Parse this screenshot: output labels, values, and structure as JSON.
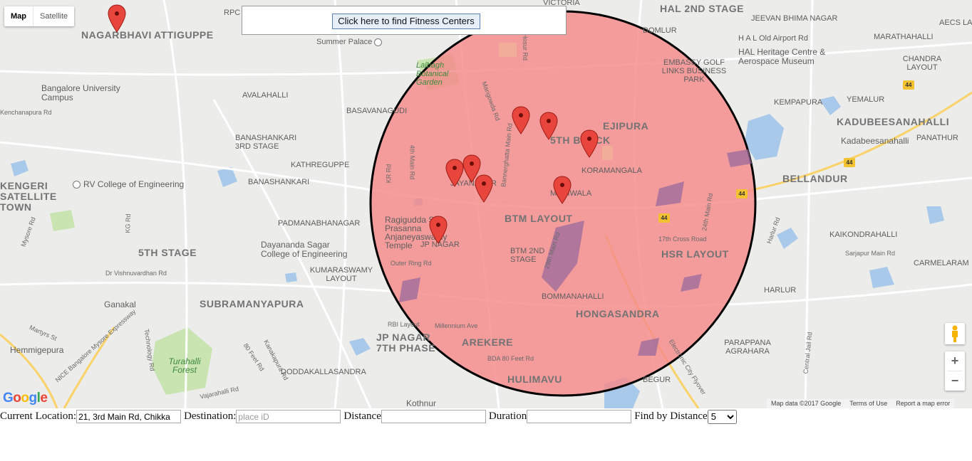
{
  "map": {
    "type_buttons": {
      "map": "Map",
      "satellite": "Satellite"
    },
    "find_button": "Click here to find Fitness Centers",
    "zoom_in": "+",
    "zoom_out": "−",
    "logo": "Google",
    "attribution": {
      "data": "Map data ©2017 Google",
      "terms": "Terms of Use",
      "report": "Report a map error"
    },
    "colors": {
      "radius_fill": "#f48a8a",
      "radius_stroke": "#000000",
      "pin": "#e8463d",
      "water": "#a9c9ea",
      "park": "#c9e3b1"
    },
    "labels": {
      "nagarbhavi": "NAGARBHAVI",
      "attiguppe": "ATTIGUPPE",
      "rpc_layout": "RPC LAYOUT",
      "victoria": "VICTORIA",
      "hal_2nd_stage": "HAL 2ND STAGE",
      "jeevan_bhima": "JEEVAN BHIMA NAGAR",
      "hal_old_airport": "H A L Old Airport Rd",
      "marathahalli": "MARATHAHALLI",
      "aecs": "AECS LAY",
      "summer_palace": "Summer Palace",
      "domlur": "DOMLUR",
      "hal_heritage": "HAL Heritage Centre & Aerospace Museum",
      "chandra_layout": "CHANDRA LAYOUT",
      "lalbagh": "Lalbagh Botanical Garden",
      "embassy": "EMBASSY GOLF LINKS BUSINESS PARK",
      "bangalore_univ": "Bangalore University Campus",
      "avalahalli": "AVALAHALLI",
      "yemalur": "YEMALUR",
      "kenchanapura": "Kenchanapura Rd",
      "basavanagudi": "BASAVANAGUDI",
      "kempapura": "KEMPAPURA",
      "ejipura": "EJIPURA",
      "kadubeesanahalli": "KADUBEESANAHALLI",
      "fifth_block": "5TH BLOCK",
      "kadabeesanahalli": "Kadabeesanahalli",
      "panathur": "PANATHUR",
      "banashankari_3": "BANASHANKARI 3RD STAGE",
      "kathreguppe": "KATHREGUPPE",
      "koramangala": "KORAMANGALA",
      "kengeri": "KENGERI SATELLITE TOWN",
      "banashankari": "BANASHANKARI",
      "jayanagar": "JAYANAGAR",
      "bellandur": "BELLANDUR",
      "rv_college": "RV College of Engineering",
      "madiwala": "MADIWALA",
      "btm_layout": "BTM LAYOUT",
      "padmanabhanagar": "PADMANABHANAGAR",
      "ragigudda": "Ragigudda Sri Prasanna Anjaneyaswamy Temple",
      "kaikondrahalli": "KAIKONDRAHALLI",
      "jp_nagar": "JP NAGAR",
      "seventeenth_cross": "17th Cross Road",
      "dayananda": "Dayananda Sagar College of Engineering",
      "fifth_stage": "5TH STAGE",
      "btm_2nd": "BTM 2ND STAGE",
      "hsr_layout": "HSR LAYOUT",
      "sarjapur": "Sarjapur Main Rd",
      "carmelaram": "CARMELARAM",
      "outer_ring": "Outer Ring Rd",
      "kumaraswamy": "KUMARASWAMY LAYOUT",
      "vishnuvardhan": "Dr Vishnuvardhan Rd",
      "bommanahalli": "BOMMANAHALLI",
      "harlur": "HARLUR",
      "ganakal": "Ganakal",
      "subramanyapura": "SUBRAMANYAPURA",
      "hongasandra": "HONGASANDRA",
      "millennium": "Millennium Ave",
      "rbi_layout": "RBI Layout",
      "jp_nagar_7": "JP NAGAR 7TH PHASE",
      "arekere": "AREKERE",
      "parappana": "PARAPPANA AGRAHARA",
      "hemmigepura": "Hemmigepura",
      "turahalli": "Turahalli Forest",
      "doddakallasandra": "DODDAKALLASANDRA",
      "bda_80ft": "BDA 80 Feet Rd",
      "hulimavu": "HULIMAVU",
      "electronic_city": "Electronic City Flyover",
      "nice_road": "NICE Bangalore Mysore Expressway",
      "vajarahalli": "Vajarahalli Rd",
      "begur": "BEGUR",
      "kothnur": "Kothnur",
      "mangowda": "Marigowda Rd",
      "hosur_rd": "Hosur Rd",
      "bannerghatta": "Bannerghatta Main Rd",
      "fourth_main": "4th Main Rd",
      "kr_rd": "KR Rd",
      "29th_main": "29th Main Rd",
      "24th_main": "24th Main Rd",
      "central_jail": "Central Jail Rd",
      "mysore_rd": "Mysore Rd",
      "kg_rd": "KG Rd",
      "martyrs": "Martyrs St",
      "technology": "Technology Rd",
      "kanakapura": "Kanakapura Rd",
      "eighty_ft": "80 Feet Rd",
      "harlur_rd": "Harlur Rd",
      "highway_44": "44"
    }
  },
  "form": {
    "current_location_label": "Current Location:",
    "current_location_value": "21, 3rd Main Rd, Chikka",
    "destination_label": "Destination:",
    "destination_placeholder": "place iD",
    "distance_label": "Distance",
    "distance_value": "",
    "duration_label": "Duration",
    "duration_value": "",
    "find_by_distance_label": "Find by Distance",
    "find_by_distance_selected": "5"
  }
}
